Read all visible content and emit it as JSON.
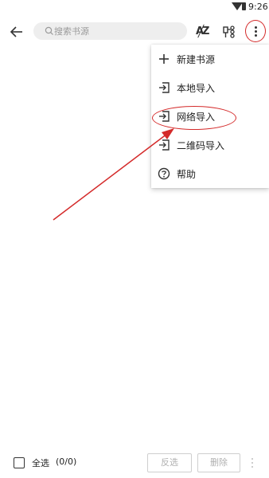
{
  "status_bar": {
    "time": "9:26"
  },
  "toolbar": {
    "search_placeholder": "搜索书源",
    "sort_icon_text_a": "A",
    "sort_icon_text_z": "Z"
  },
  "menu": {
    "items": [
      {
        "label": "新建书源",
        "icon": "plus-icon"
      },
      {
        "label": "本地导入",
        "icon": "import-icon"
      },
      {
        "label": "网络导入",
        "icon": "import-icon"
      },
      {
        "label": "二维码导入",
        "icon": "import-icon"
      },
      {
        "label": "帮助",
        "icon": "help-icon"
      }
    ]
  },
  "bottom_bar": {
    "select_all_label": "全选",
    "count": "(0/0)",
    "invert_label": "反选",
    "delete_label": "删除"
  },
  "colors": {
    "annotation": "#d42a2a",
    "icon": "#333333",
    "disabled_text": "#b0b0b0"
  }
}
